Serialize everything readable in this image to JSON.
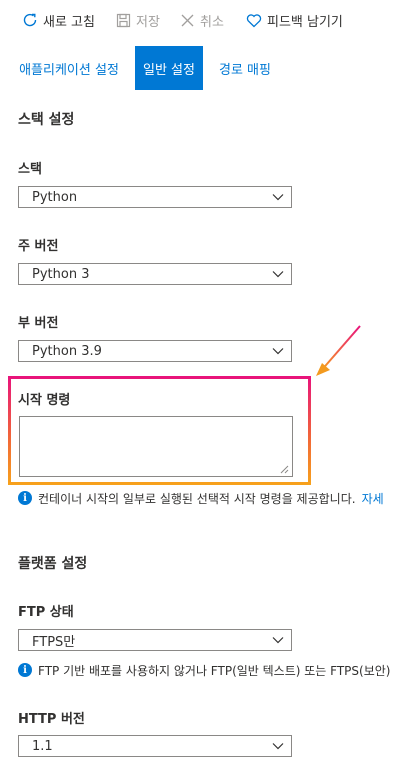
{
  "toolbar": {
    "refresh": {
      "label": "새로 고침",
      "icon": "refresh-icon",
      "enabled": true
    },
    "save": {
      "label": "저장",
      "icon": "save-icon",
      "enabled": false
    },
    "discard": {
      "label": "취소",
      "icon": "close-icon",
      "enabled": false
    },
    "feedback": {
      "label": "피드백 남기기",
      "icon": "heart-icon",
      "enabled": true
    }
  },
  "tabs": [
    {
      "label": "애플리케이션 설정",
      "active": false
    },
    {
      "label": "일반 설정",
      "active": true
    },
    {
      "label": "경로 매핑",
      "active": false
    }
  ],
  "stack_settings": {
    "heading": "스택 설정",
    "stack": {
      "label": "스택",
      "value": "Python"
    },
    "major_version": {
      "label": "주 버전",
      "value": "Python 3"
    },
    "minor_version": {
      "label": "부 버전",
      "value": "Python 3.9"
    },
    "startup_command": {
      "label": "시작 명령",
      "value": "",
      "info": "컨테이너 시작의 일부로 실행된 선택적 시작 명령을 제공합니다.",
      "info_link": "자세"
    }
  },
  "platform_settings": {
    "heading": "플랫폼 설정",
    "ftp_state": {
      "label": "FTP 상태",
      "value": "FTPS만",
      "info": "FTP 기반 배포를 사용하지 않거나 FTP(일반 텍스트) 또는 FTPS(보안)"
    },
    "http_version": {
      "label": "HTTP 버전",
      "value": "1.1"
    }
  },
  "colors": {
    "accent": "#0078d4",
    "highlight_gradient": [
      "#e8127c",
      "#f7a21b"
    ],
    "arrow": "#f39a1f"
  }
}
